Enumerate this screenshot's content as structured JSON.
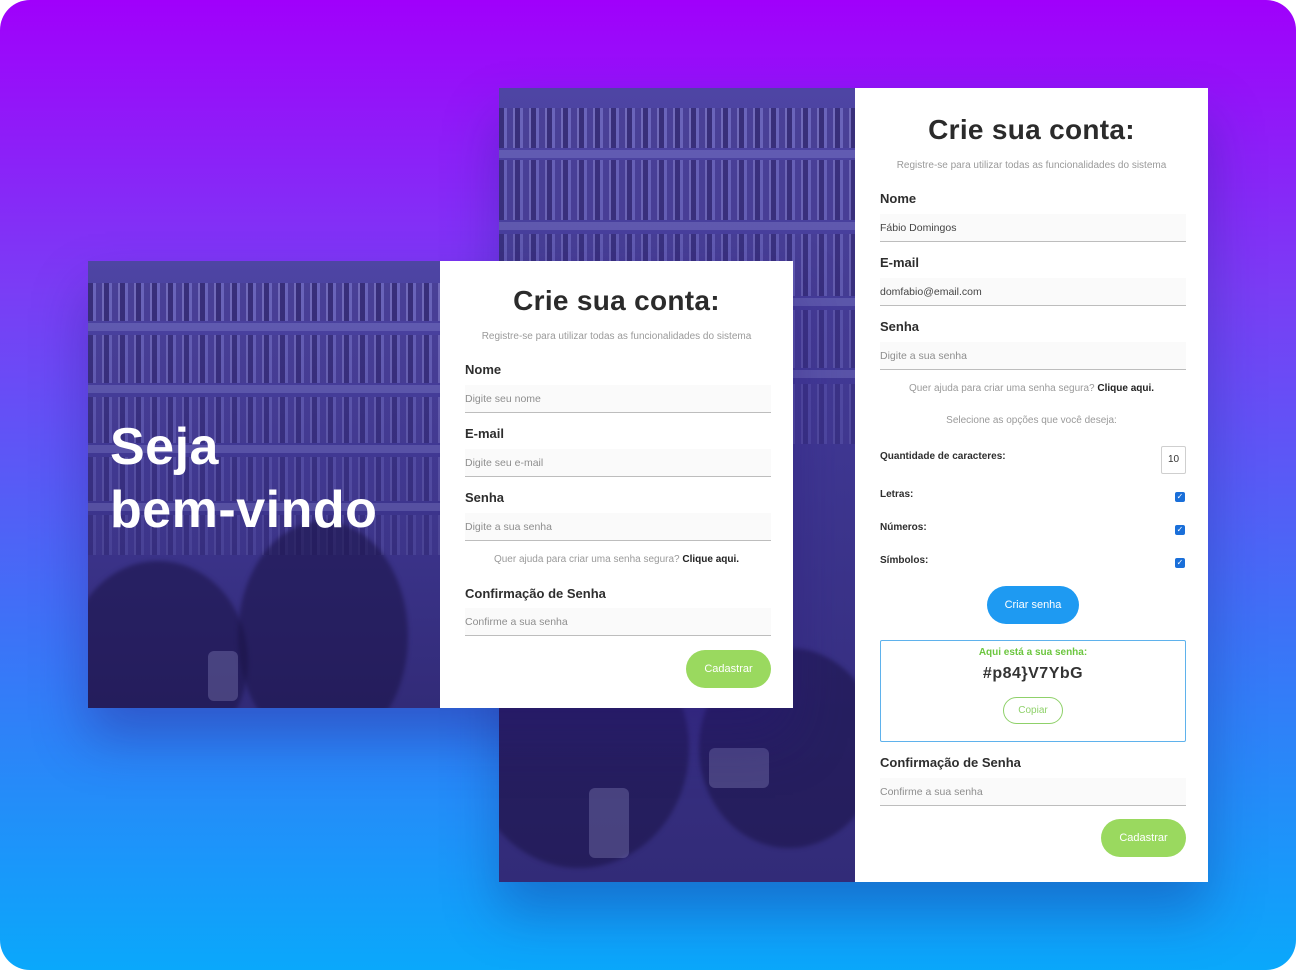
{
  "colors": {
    "gradient_top": "#a000fb",
    "gradient_bottom": "#0aa8fb",
    "green_button": "#9ad95f",
    "blue_button": "#1e9af2",
    "checkbox": "#1a6fd9",
    "result_border": "#5fb2ec"
  },
  "small_screen": {
    "welcome_line1": "Seja",
    "welcome_line2": "bem-vindo",
    "title": "Crie sua conta:",
    "subtitle": "Registre-se para utilizar todas as funcionalidades do sistema",
    "name": {
      "label": "Nome",
      "placeholder": "Digite seu nome",
      "value": ""
    },
    "email": {
      "label": "E-mail",
      "placeholder": "Digite seu e-mail",
      "value": ""
    },
    "password": {
      "label": "Senha",
      "placeholder": "Digite a sua senha",
      "value": ""
    },
    "help_text": "Quer ajuda para criar uma senha segura?",
    "help_link": "Clique aqui.",
    "confirm": {
      "label": "Confirmação de Senha",
      "placeholder": "Confirme a sua senha",
      "value": ""
    },
    "submit_label": "Cadastrar"
  },
  "big_screen": {
    "title": "Crie sua conta:",
    "subtitle": "Registre-se para utilizar todas as funcionalidades do sistema",
    "name": {
      "label": "Nome",
      "placeholder": "Digite seu nome",
      "value": "Fábio Domingos"
    },
    "email": {
      "label": "E-mail",
      "placeholder": "Digite seu e-mail",
      "value": "domfabio@email.com"
    },
    "password": {
      "label": "Senha",
      "placeholder": "Digite a sua senha",
      "value": ""
    },
    "help_text": "Quer ajuda para criar uma senha segura?",
    "help_link": "Clique aqui.",
    "options_prompt": "Selecione as opções que você deseja:",
    "char_count_label": "Quantidade de caracteres:",
    "char_count_value": "10",
    "letters_label": "Letras:",
    "letters_checked": true,
    "numbers_label": "Números:",
    "numbers_checked": true,
    "symbols_label": "Símbolos:",
    "symbols_checked": true,
    "generate_label": "Criar senha",
    "result_title": "Aqui está a sua senha:",
    "result_password": "#p84}V7YbG",
    "copy_label": "Copiar",
    "confirm": {
      "label": "Confirmação de Senha",
      "placeholder": "Confirme a sua senha",
      "value": ""
    },
    "submit_label": "Cadastrar",
    "checkmark": "✓"
  }
}
